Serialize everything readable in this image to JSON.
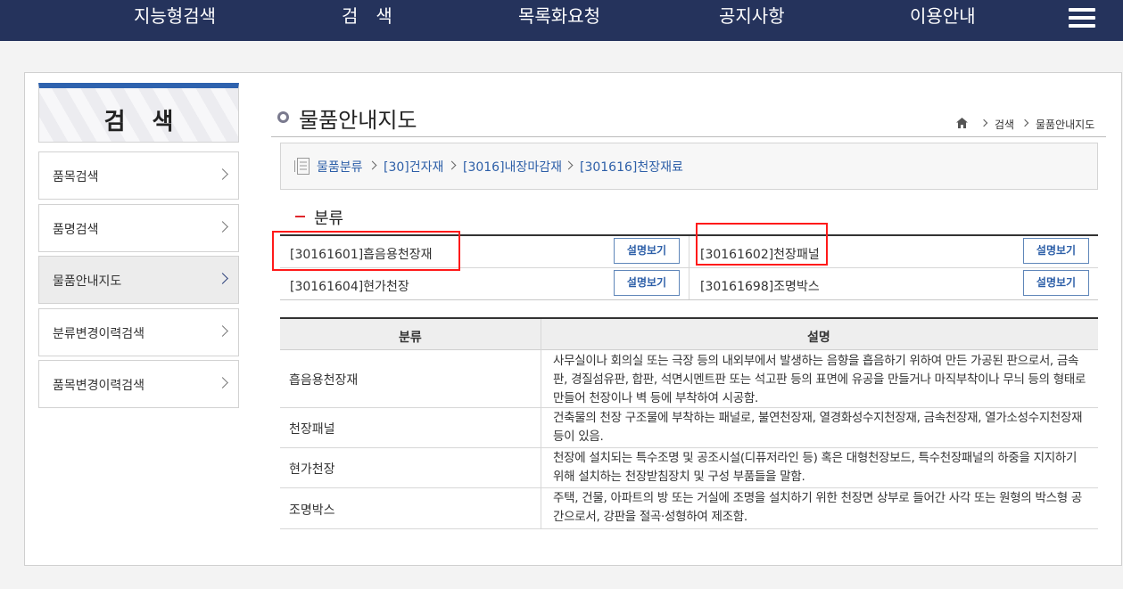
{
  "nav": {
    "items": [
      "지능형검색",
      "검　색",
      "목록화요청",
      "공지사항",
      "이용안내"
    ],
    "menu_icon": "hamburger-menu-icon"
  },
  "sidebar": {
    "title": "검색",
    "items": [
      "품목검색",
      "품명검색",
      "물품안내지도",
      "분류변경이력검색",
      "품목변경이력검색"
    ],
    "active": "물품안내지도"
  },
  "page": {
    "title": "물품안내지도",
    "breadcrumb": [
      "검색",
      "물품안내지도"
    ]
  },
  "category_path": [
    "물품분류",
    "[30]건자재",
    "[3016]내장마감재",
    "[301616]천장재료"
  ],
  "section": {
    "title": "분류"
  },
  "categories": [
    {
      "name": "[30161601]흡음용천장재",
      "button": "설명보기"
    },
    {
      "name": "[30161602]천장패널",
      "button": "설명보기"
    },
    {
      "name": "[30161604]현가천장",
      "button": "설명보기"
    },
    {
      "name": "[30161698]조명박스",
      "button": "설명보기"
    }
  ],
  "desc_table": {
    "headers": [
      "분류",
      "설명"
    ],
    "rows": [
      {
        "name": "흡음용천장재",
        "desc": "사무실이나 회의실 또는 극장 등의 내외부에서 발생하는 음향을 흡음하기 위하여 만든 가공된 판으로서, 금속판, 경질섬유판, 합판, 석면시멘트판 또는 석고판 등의 표면에 유공을 만들거나 마직부착이나 무늬 등의 형태로 만들어 천장이나 벽 등에 부착하여 시공함."
      },
      {
        "name": "천장패널",
        "desc": "건축물의 천장 구조물에 부착하는 패널로, 불연천장재, 열경화성수지천장재, 금속천장재, 열가소성수지천장재 등이 있음."
      },
      {
        "name": "현가천장",
        "desc": "천장에 설치되는 특수조명 및 공조시설(디퓨저라인 등) 혹은 대형천장보드, 특수천장패널의 하중을 지지하기 위해 설치하는 천장받침장치 및 구성 부품들을 말함."
      },
      {
        "name": "조명박스",
        "desc": "주택, 건물, 아파트의 방 또는 거실에 조명을 설치하기 위한 천장면 상부로 들어간 사각 또는 원형의 박스형 공간으로서, 강판을 절곡·성형하여 제조함."
      }
    ]
  },
  "colors": {
    "nav_bg": "#25335c",
    "accent_blue": "#2e62ae",
    "link": "#2d5fa8",
    "highlight_red": "#ff1a1a"
  }
}
